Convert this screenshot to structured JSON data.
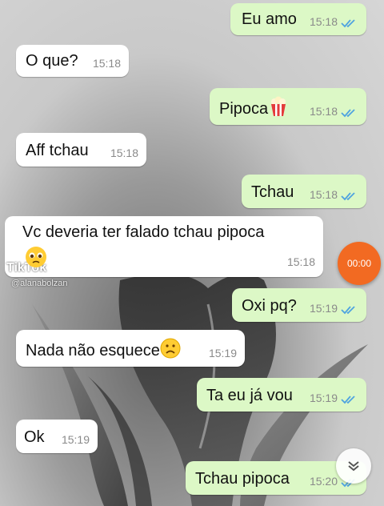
{
  "messages": [
    {
      "dir": "out",
      "text": "Eu amo",
      "time": "15:18"
    },
    {
      "dir": "in",
      "text": "O que?",
      "time": "15:18"
    },
    {
      "dir": "out",
      "text": "Pipoca",
      "time": "15:18",
      "emoji": "popcorn-icon"
    },
    {
      "dir": "in",
      "text": "Aff tchau",
      "time": "15:18"
    },
    {
      "dir": "out",
      "text": "Tchau",
      "time": "15:18"
    },
    {
      "dir": "in",
      "text": "Vc deveria ter falado tchau pipoca",
      "time": "15:18"
    },
    {
      "dir": "out",
      "text": "Oxi pq?",
      "time": "15:19"
    },
    {
      "dir": "in",
      "text": "Nada não esquece",
      "time": "15:19",
      "emoji": "frowning-face-icon"
    },
    {
      "dir": "out",
      "text": "Ta eu já vou",
      "time": "15:19"
    },
    {
      "dir": "in",
      "text": "Ok",
      "time": "15:19"
    },
    {
      "dir": "out",
      "text": "Tchau pipoca",
      "time": "15:20"
    }
  ],
  "overlay": {
    "record_timer": "00:00",
    "watermark": "TikTok",
    "watermark_user": "@alanabolzan"
  },
  "colors": {
    "outgoing_bubble": "#dcf8c6",
    "incoming_bubble": "#ffffff",
    "read_ticks": "#4fa3e0",
    "record_button": "#f26a22"
  }
}
